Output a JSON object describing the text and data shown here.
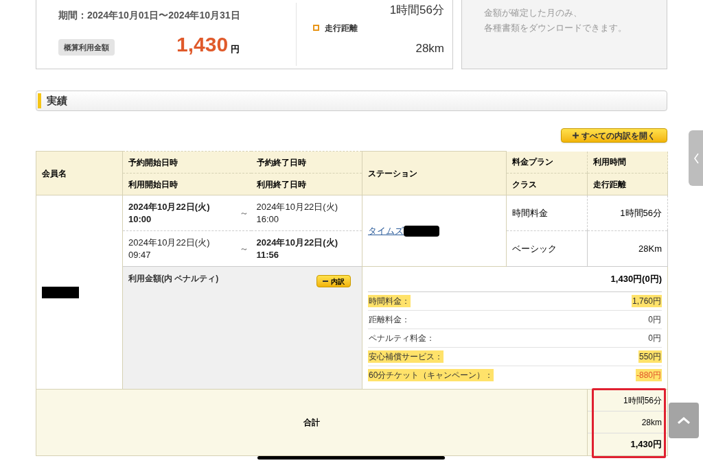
{
  "summary": {
    "period": "期間：2024年10月01日〜2024年10月31日",
    "amount_label": "概算利用金額",
    "amount": "1,430",
    "amount_unit": "円",
    "usage_time": "1時間56分",
    "distance_label": "走行距離",
    "distance": "28km"
  },
  "notice": {
    "lines": [
      "金額が確定した月のみ、",
      "各種書類をダウンロードできます。"
    ]
  },
  "section_title": "実績",
  "expand_all_button": {
    "label": "すべての内訳を開く"
  },
  "table": {
    "headers": {
      "member": "会員名",
      "reservation_start": "予約開始日時",
      "reservation_end": "予約終了日時",
      "usage_start": "利用開始日時",
      "usage_end": "利用終了日時",
      "station": "ステーション",
      "plan": "料金プラン",
      "class": "クラス",
      "usage_time": "利用時間",
      "distance": "走行距離"
    },
    "record": {
      "reservation": {
        "start": {
          "date": "2024年10月22日(火)",
          "time": "10:00",
          "bold": true
        },
        "separator": "～",
        "end": {
          "date": "2024年10月22日(火)",
          "time": "16:00",
          "bold": false
        }
      },
      "usage": {
        "start": {
          "date": "2024年10月22日(火)",
          "time": "09:47",
          "bold": false
        },
        "separator": "～",
        "end": {
          "date": "2024年10月22日(火)",
          "time": "11:56",
          "bold": true
        }
      },
      "station": "タイムズ",
      "plan": "時間料金",
      "class": "ベーシック",
      "usage_time": "1時間56分",
      "distance": "28Km"
    },
    "fee": {
      "label": "利用金額(内 ペナルティ)",
      "toggle_button": "内訳",
      "total": "1,430円(0円)",
      "items": [
        {
          "label": "時間料金：",
          "value": "1,760円",
          "highlighted": true,
          "negative": false
        },
        {
          "label": "距離料金：",
          "value": "0円",
          "highlighted": false,
          "negative": false
        },
        {
          "label": "ペナルティ料金：",
          "value": "0円",
          "highlighted": false,
          "negative": false
        },
        {
          "label": "安心補償サービス：",
          "value": "550円",
          "highlighted": true,
          "negative": false
        },
        {
          "label": "60分チケット（キャンペーン）：",
          "value": "-880円",
          "highlighted": true,
          "negative": true
        }
      ]
    },
    "totals": {
      "label": "合計",
      "usage_time": "1時間56分",
      "distance": "28km",
      "amount": "1,430円"
    }
  }
}
